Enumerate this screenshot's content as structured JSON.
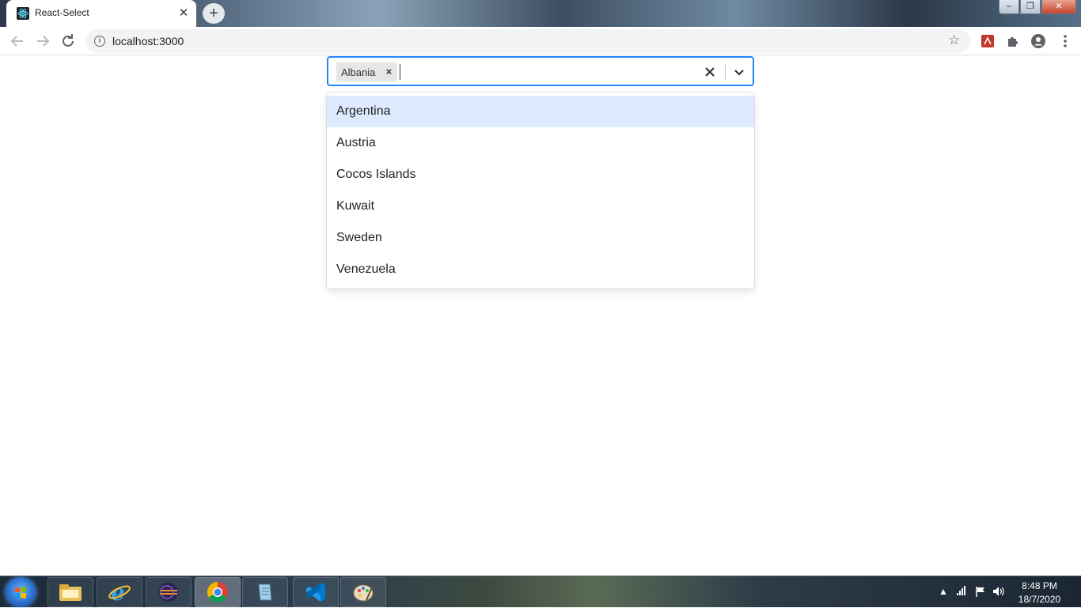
{
  "browser": {
    "tab_title": "React-Select",
    "tab_close": "✕",
    "new_tab": "+",
    "url": "localhost:3000",
    "window_controls": {
      "minimize": "–",
      "restore": "❐",
      "close": "✕"
    }
  },
  "select": {
    "selected_values": [
      "Albania"
    ],
    "remove_glyph": "×",
    "options": [
      "Argentina",
      "Austria",
      "Cocos Islands",
      "Kuwait",
      "Sweden",
      "Venezuela"
    ],
    "focused_option_index": 0,
    "accent_color": "#2684ff",
    "focused_color": "#deebff"
  },
  "taskbar": {
    "apps": [
      "windows-explorer",
      "internet-explorer",
      "eclipse",
      "chrome",
      "notepad",
      "vscode",
      "paint"
    ],
    "active_app": "chrome",
    "time": "8:48 PM",
    "date": "18/7/2020"
  }
}
